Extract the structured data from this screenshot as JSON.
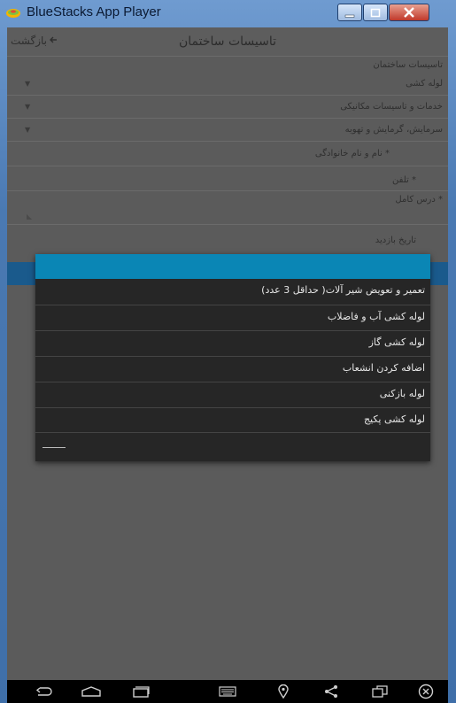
{
  "window": {
    "title": "BlueStacks App Player",
    "icons": [
      "bluestacks-logo",
      "minimize-icon",
      "maximize-icon",
      "close-icon"
    ]
  },
  "app": {
    "back_label": "بازگشت",
    "title": "تاسیسات ساختمان",
    "form": {
      "section_label": "تاسیسات ساختمان",
      "fields": [
        {
          "label": "لوله کشی",
          "type": "dropdown"
        },
        {
          "label": "خدمات و تاسیسات مکانیکی",
          "type": "dropdown"
        },
        {
          "label": "سرمایش، گرمایش و تهویه",
          "type": "dropdown"
        },
        {
          "label": "نام و نام خانوادگی *",
          "type": "text"
        },
        {
          "label": "تلفن *",
          "type": "text"
        },
        {
          "label": "درس کامل *",
          "type": "text"
        },
        {
          "label": "تاریخ بازدید",
          "type": "text"
        }
      ]
    }
  },
  "dialog": {
    "options": [
      "تعمیر و تعویض شیر آلات( حداقل 3 عدد)",
      "لوله کشی آب و فاضلاب",
      "لوله کشی گاز",
      "اضافه کردن انشعاب",
      "لوله بازکنی",
      "لوله کشی پکیج"
    ]
  },
  "navbar": {
    "icons": [
      "back-icon",
      "home-icon",
      "recent-apps-icon",
      "keyboard-icon",
      "location-icon",
      "share-icon",
      "multi-window-icon",
      "close-app-icon"
    ]
  },
  "colors": {
    "dialog_header": "#0a86b5",
    "dialog_bg": "#262626",
    "screen_bg": "#5b5b5b",
    "window_frame": "#4a79b2"
  }
}
